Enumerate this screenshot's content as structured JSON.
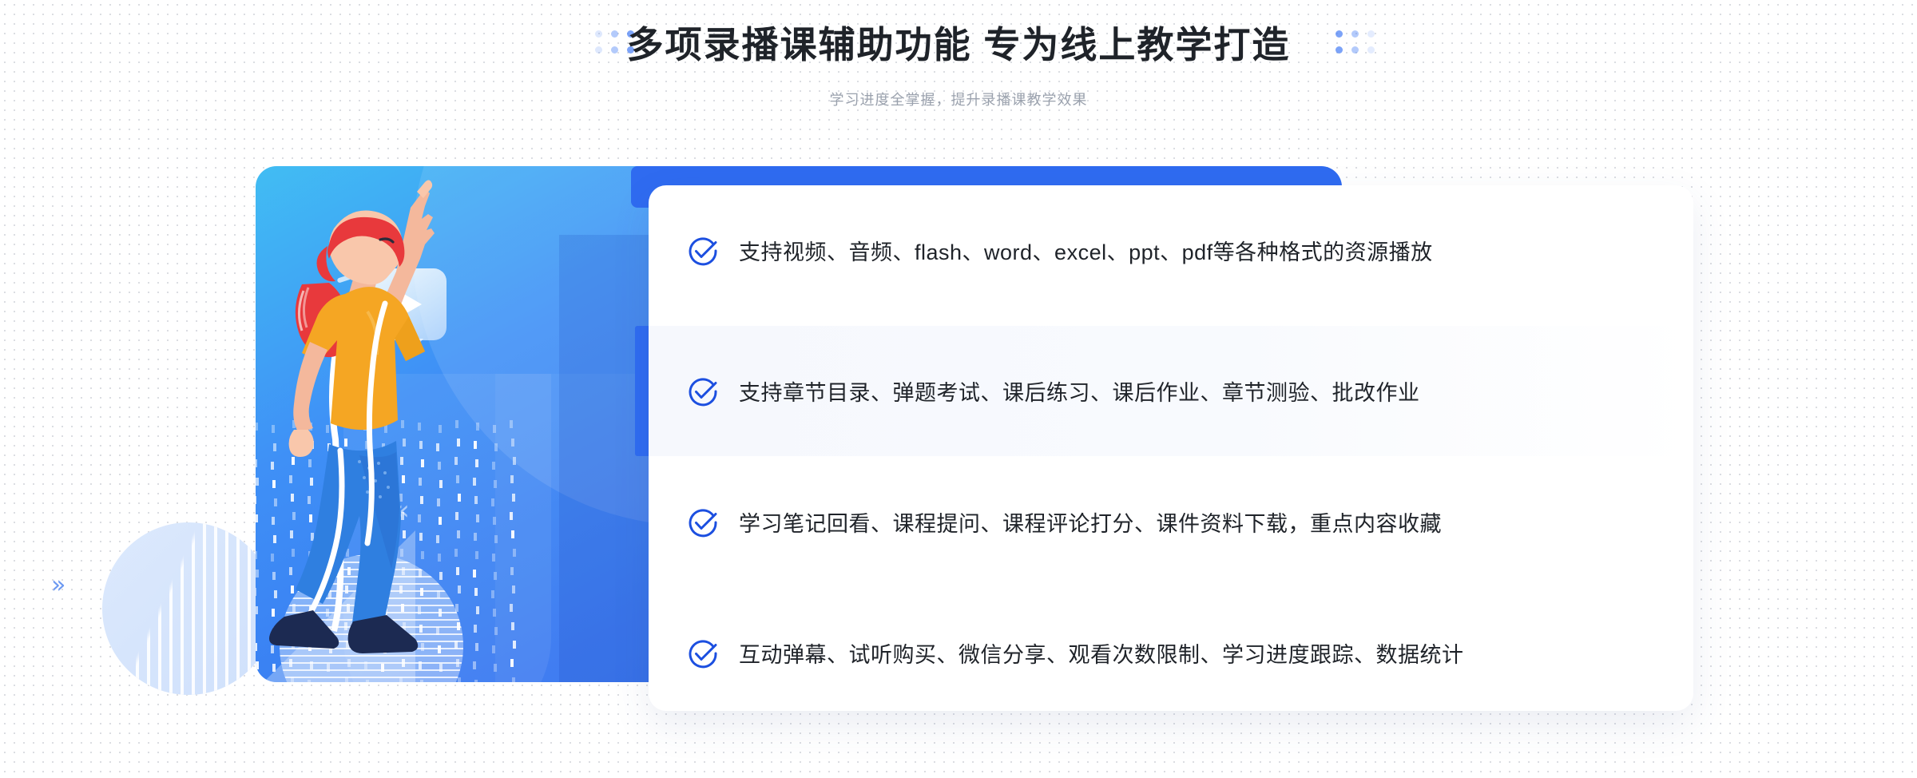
{
  "header": {
    "title": "多项录播课辅助功能 专为线上教学打造",
    "subtitle": "学习进度全掌握，提升录播课教学效果",
    "dots_left_icon": "dot-grid-decoration",
    "dots_right_icon": "dot-grid-decoration"
  },
  "illustration": {
    "play_icon": "play-button-icon",
    "bubble_icon": "speech-bubble-icon",
    "chevron_inner_icon": "chevron-double-left-icon",
    "chevron_outer_icon": "chevron-double-right-icon",
    "chevron_inner_glyph": "«",
    "chevron_outer_glyph": "»",
    "character_icon": "person-pointing-up-illustration",
    "circle_icon": "striped-circle-decoration"
  },
  "features": [
    {
      "icon": "check-circle-icon",
      "text": "支持视频、音频、flash、word、excel、ppt、pdf等各种格式的资源播放",
      "highlighted": false
    },
    {
      "icon": "check-circle-icon",
      "text": "支持章节目录、弹题考试、课后练习、课后作业、章节测验、批改作业",
      "highlighted": true
    },
    {
      "icon": "check-circle-icon",
      "text": "学习笔记回看、课程提问、课程评论打分、课件资料下载，重点内容收藏",
      "highlighted": false
    },
    {
      "icon": "check-circle-icon",
      "text": "互动弹幕、试听购买、微信分享、观看次数限制、学习进度跟踪、数据统计",
      "highlighted": false
    }
  ],
  "colors": {
    "accent_blue": "#2f6bf0",
    "check_blue": "#1c4fe0",
    "panel_cyan": "#41bdf3",
    "panel_blue": "#3572f0",
    "title_text": "#1f2329",
    "subtitle_text": "#9aa1ad",
    "highlight_row_bg": "#f6f8fd",
    "shirt_yellow": "#f5a623",
    "hair_red": "#e8393c",
    "jeans_blue": "#2f7fe0",
    "shoe_navy": "#1c2a52"
  }
}
